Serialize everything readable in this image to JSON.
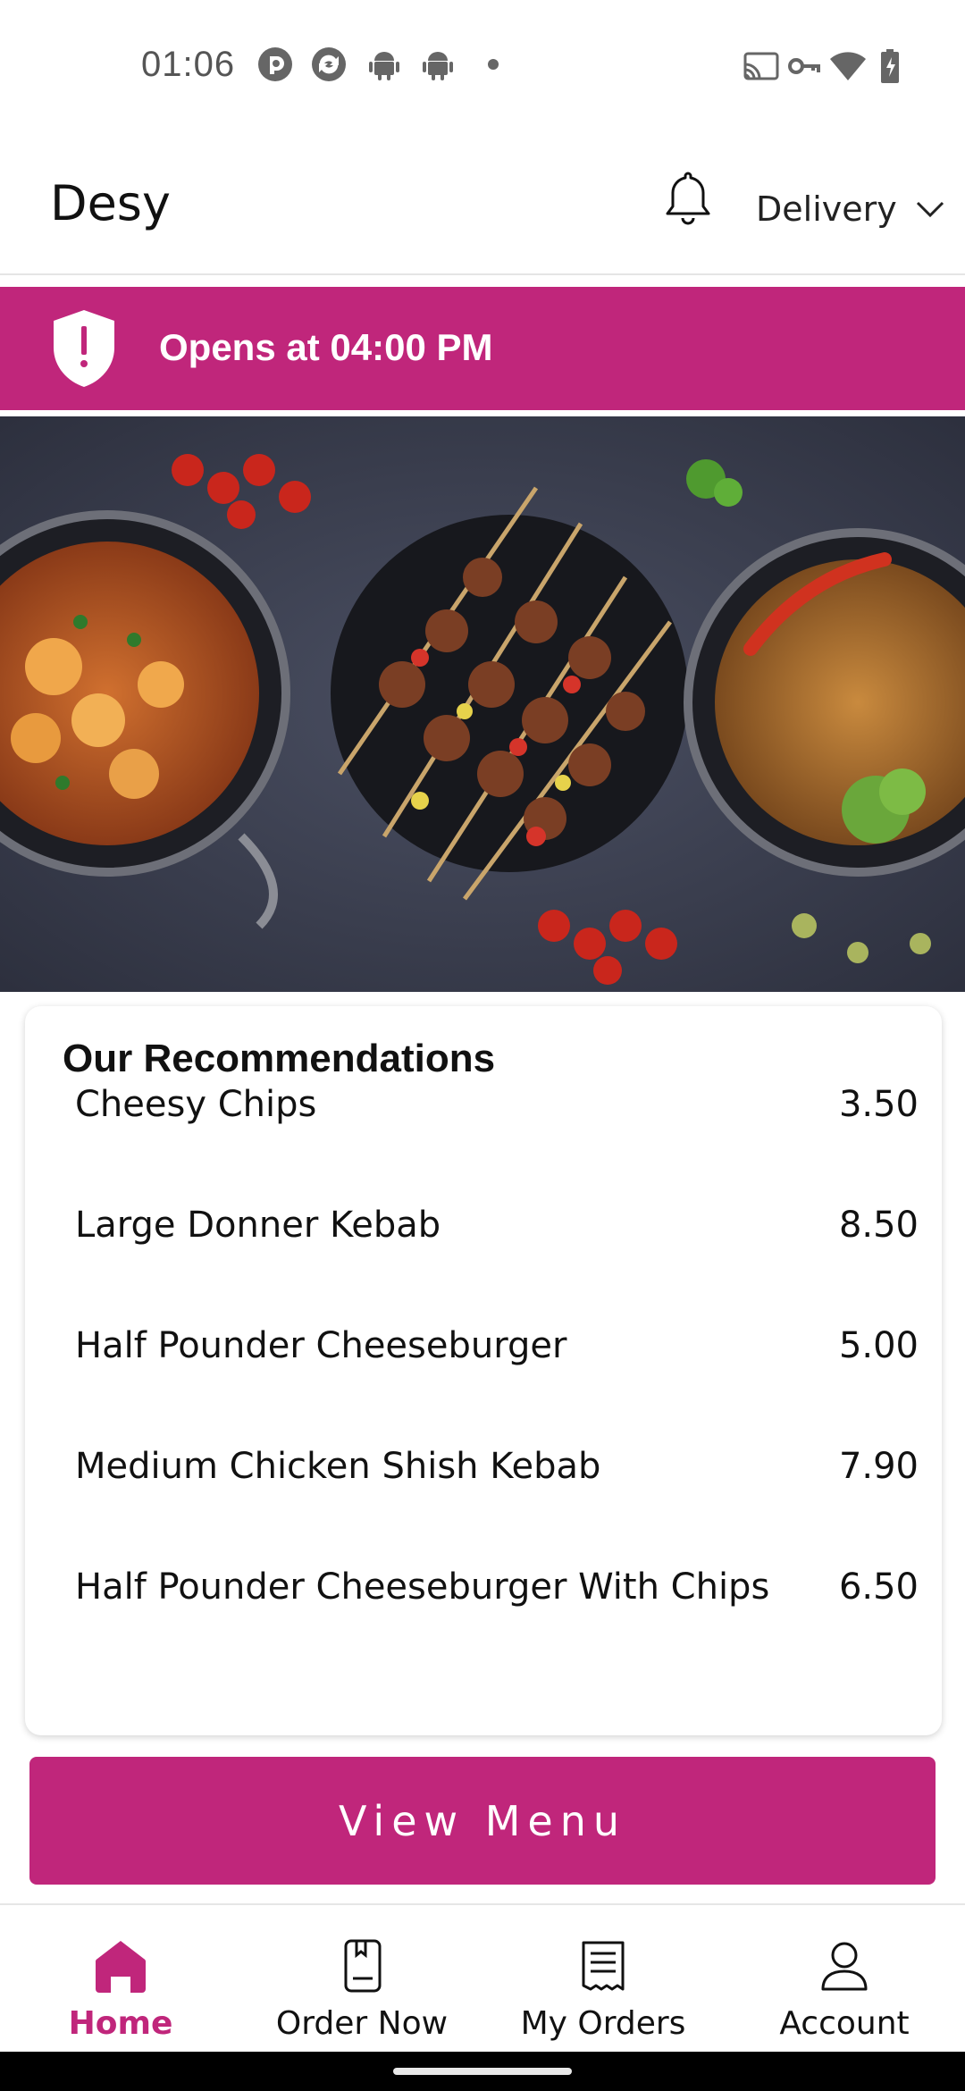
{
  "status_bar": {
    "time": "01:06",
    "left_icons": [
      "pocket-casts-icon",
      "pocket-casts-alt-icon",
      "android-icon",
      "android-icon",
      "dot-icon"
    ],
    "right_icons": [
      "cast-icon",
      "vpn-key-icon",
      "wifi-icon",
      "battery-charging-icon"
    ]
  },
  "header": {
    "title": "Desy",
    "notification_icon": "bell-icon",
    "delivery_label": "Delivery",
    "dropdown_icon": "chevron-down-icon"
  },
  "banner": {
    "icon": "shield-alert-icon",
    "text": "Opens at 04:00 PM",
    "color": "#c0267b"
  },
  "hero": {
    "description_icon": "food-banner-image"
  },
  "recommendations": {
    "title": "Our Recommendations",
    "items": [
      {
        "name": "Cheesy Chips",
        "price": "3.50"
      },
      {
        "name": "Large Donner Kebab",
        "price": "8.50"
      },
      {
        "name": "Half Pounder Cheeseburger",
        "price": "5.00"
      },
      {
        "name": "Medium Chicken Shish Kebab",
        "price": "7.90"
      },
      {
        "name": "Half Pounder Cheeseburger With Chips",
        "price": "6.50"
      }
    ]
  },
  "view_menu": {
    "label": "View Menu"
  },
  "bottom_nav": {
    "items": [
      {
        "label": "Home",
        "icon": "home-icon",
        "active": true
      },
      {
        "label": "Order Now",
        "icon": "order-book-icon",
        "active": false
      },
      {
        "label": "My Orders",
        "icon": "receipt-icon",
        "active": false
      },
      {
        "label": "Account",
        "icon": "account-icon",
        "active": false
      }
    ],
    "accent": "#c0267b"
  }
}
